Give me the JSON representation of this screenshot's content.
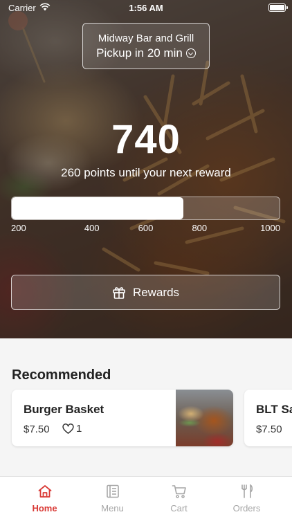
{
  "status_bar": {
    "carrier": "Carrier",
    "time": "1:56 AM"
  },
  "location": {
    "name": "Midway Bar and Grill",
    "pickup": "Pickup in 20 min"
  },
  "rewards": {
    "points": "740",
    "message": "260 points until your next reward",
    "progress_value": 740,
    "scale_min": 100,
    "scale_max": 1100,
    "ticks": [
      "200",
      "400",
      "600",
      "800",
      "1000"
    ],
    "button_label": "Rewards"
  },
  "recommended": {
    "title": "Recommended",
    "items": [
      {
        "name": "Burger Basket",
        "price": "$7.50",
        "likes": "1"
      },
      {
        "name": "BLT Sa",
        "price": "$7.50"
      }
    ]
  },
  "tabs": [
    {
      "label": "Home",
      "icon": "home-icon",
      "active": true
    },
    {
      "label": "Menu",
      "icon": "menu-icon",
      "active": false
    },
    {
      "label": "Cart",
      "icon": "cart-icon",
      "active": false
    },
    {
      "label": "Orders",
      "icon": "orders-icon",
      "active": false
    }
  ],
  "colors": {
    "accent": "#d93a36",
    "inactive_tab": "#a6a6a6"
  }
}
